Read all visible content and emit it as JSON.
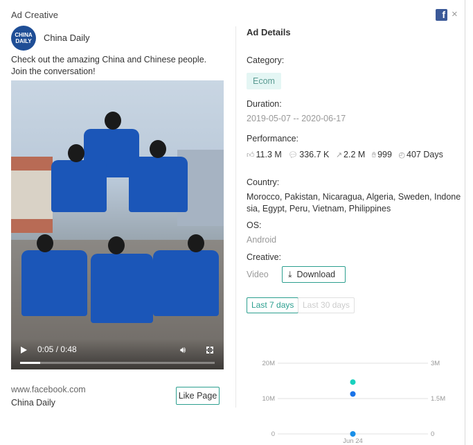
{
  "header": {
    "title": "Ad Creative",
    "close": "×",
    "fb": "f"
  },
  "advertiser": {
    "logo_text": "CHINA DAILY",
    "name": "China Daily"
  },
  "ad_text": "Check out the amazing China and Chinese people. Join the conversation!",
  "video": {
    "time": "0:05 / 0:48",
    "progress": 0.104
  },
  "footer": {
    "url": "www.facebook.com",
    "page_name": "China Daily",
    "like_label": "Like Page"
  },
  "details": {
    "title": "Ad Details",
    "category_label": "Category:",
    "category": "Ecom",
    "duration_label": "Duration:",
    "duration": "2019-05-07 -- 2020-06-17",
    "performance_label": "Performance:",
    "likes": "11.3 M",
    "comments": "336.7 K",
    "shares": "2.2 M",
    "reactions": "999",
    "days": "407 Days",
    "country_label": "Country:",
    "countries": "Morocco, Pakistan, Nicaragua, Algeria, Sweden, Indonesia, Egypt, Peru, Vietnam, Philippines",
    "os_label": "OS:",
    "os": "Android",
    "creative_label": "Creative:",
    "creative": "Video",
    "download_label": "Download"
  },
  "range": {
    "last7": "Last 7 days",
    "last30": "Last 30 days"
  },
  "chart_data": {
    "type": "scatter",
    "x_categories": [
      "Jun 24"
    ],
    "left_ticks": [
      "20M",
      "10M",
      "0"
    ],
    "right_ticks": [
      "3M",
      "1.5M",
      "0"
    ],
    "left_ylim": [
      0,
      20000000
    ],
    "right_ylim": [
      0,
      3000000
    ],
    "grid": true,
    "series": [
      {
        "axis": "left",
        "color": "#1a73e8",
        "x": "Jun 24",
        "value": 11300000
      },
      {
        "axis": "right",
        "color": "#19d1be",
        "x": "Jun 24",
        "value": 2200000
      },
      {
        "axis": "left",
        "color": "#1a8fe8",
        "x": "Jun 24",
        "value": 999
      }
    ]
  },
  "colors": {
    "accent": "#2c9f8f",
    "tag_bg": "#e4f6f4"
  }
}
